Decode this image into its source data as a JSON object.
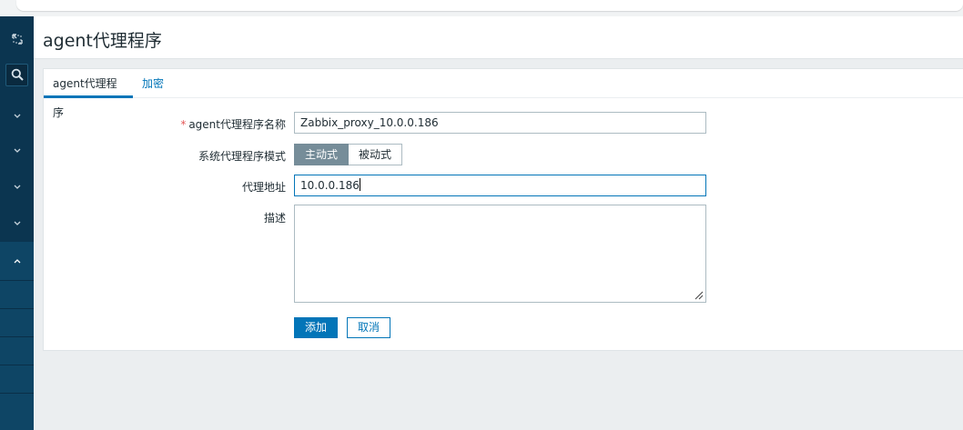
{
  "page": {
    "title": "agent代理程序"
  },
  "tabs": [
    {
      "label": "agent代理程序",
      "active": true
    },
    {
      "label": "加密",
      "active": false
    }
  ],
  "form": {
    "name_label": "agent代理程序名称",
    "name_required": "*",
    "name_value": "Zabbix_proxy_10.0.0.186",
    "mode_label": "系统代理程序模式",
    "mode_options": [
      "主动式",
      "被动式"
    ],
    "mode_selected": "主动式",
    "address_label": "代理地址",
    "address_value": "10.0.0.186",
    "description_label": "描述",
    "description_value": ""
  },
  "buttons": {
    "add": "添加",
    "cancel": "取消"
  },
  "colors": {
    "sidebar": "#0b3550",
    "accent": "#0275b8",
    "required": "#e45959",
    "segment_active": "#768d99"
  },
  "icons": [
    "collapse-icon",
    "search-icon",
    "chevron-down-icon",
    "chevron-up-icon",
    "resize-grip-icon"
  ]
}
